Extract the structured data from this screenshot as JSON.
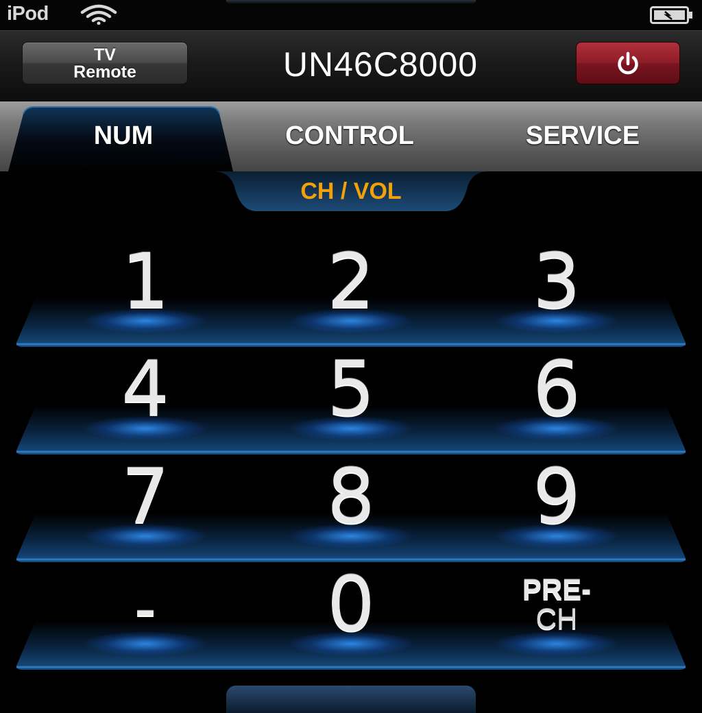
{
  "status_bar": {
    "carrier": "iPod",
    "wifi_icon": "wifi-icon",
    "battery_icon": "battery-charging-icon"
  },
  "header": {
    "left_button_line1": "TV",
    "left_button_line2": "Remote",
    "title": "UN46C8000",
    "power_icon": "power-icon",
    "power_color": "#8f1d28"
  },
  "tabs": [
    {
      "label": "NUM",
      "selected": true
    },
    {
      "label": "CONTROL",
      "selected": false
    },
    {
      "label": "SERVICE",
      "selected": false
    }
  ],
  "subtab": {
    "label": "CH / VOL",
    "color": "#f2a10b"
  },
  "keypad": {
    "rows": [
      [
        "1",
        "2",
        "3"
      ],
      [
        "4",
        "5",
        "6"
      ],
      [
        "7",
        "8",
        "9"
      ],
      [
        "-",
        "0",
        "PRE-CH"
      ]
    ],
    "prech_line1": "PRE-",
    "prech_line2": "CH"
  },
  "colors": {
    "accent_blue": "#3a8fe8",
    "background": "#000000"
  }
}
